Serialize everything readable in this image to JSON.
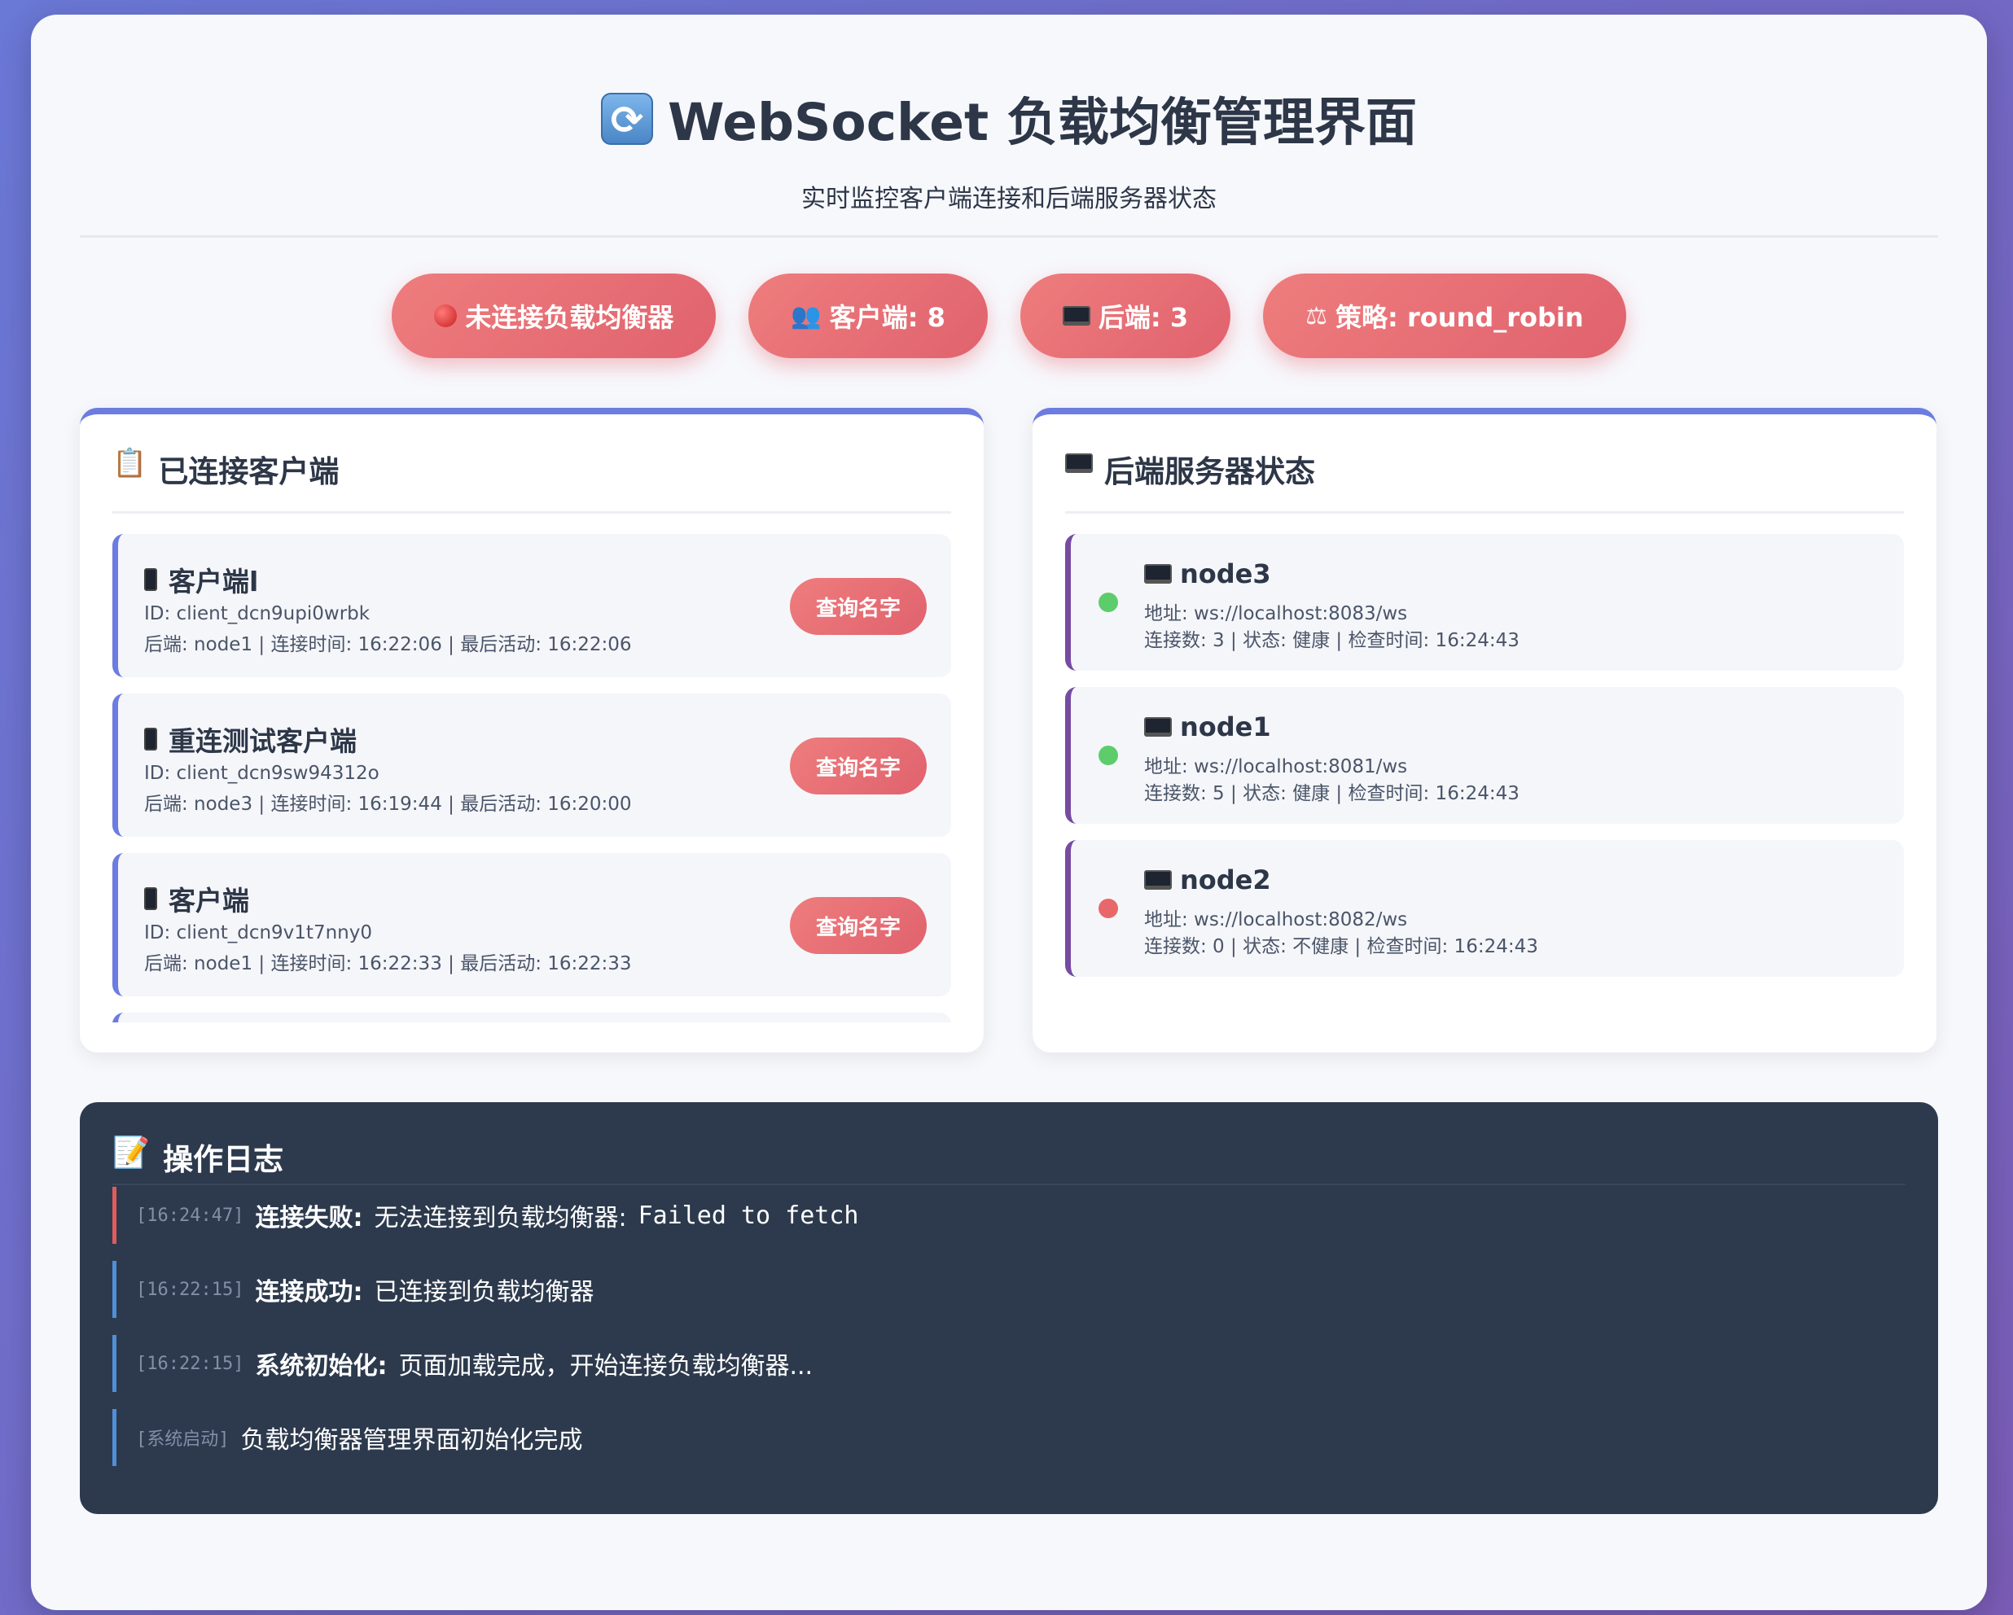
{
  "header": {
    "title": "WebSocket 负载均衡管理界面",
    "subtitle": "实时监控客户端连接和后端服务器状态"
  },
  "stats": {
    "connection": "未连接负载均衡器",
    "clients": "客户端: 8",
    "backends": "后端: 3",
    "strategy": "策略: round_robin"
  },
  "clients_panel": {
    "title": "已连接客户端",
    "button_label": "查询名字",
    "items": [
      {
        "name": "客户端l",
        "id": "ID: client_dcn9upi0wrbk",
        "details": "后端: node1 | 连接时间: 16:22:06 | 最后活动: 16:22:06"
      },
      {
        "name": "重连测试客户端",
        "id": "ID: client_dcn9sw94312o",
        "details": "后端: node3 | 连接时间: 16:19:44 | 最后活动: 16:20:00"
      },
      {
        "name": "客户端",
        "id": "ID: client_dcn9v1t7nny0",
        "details": "后端: node1 | 连接时间: 16:22:33 | 最后活动: 16:22:33"
      }
    ]
  },
  "backends_panel": {
    "title": "后端服务器状态",
    "items": [
      {
        "name": "node3",
        "address": "地址: ws://localhost:8083/ws",
        "details": "连接数: 3 | 状态: 健康 | 检查时间: 16:24:43",
        "healthy": true
      },
      {
        "name": "node1",
        "address": "地址: ws://localhost:8081/ws",
        "details": "连接数: 5 | 状态: 健康 | 检查时间: 16:24:43",
        "healthy": true
      },
      {
        "name": "node2",
        "address": "地址: ws://localhost:8082/ws",
        "details": "连接数: 0 | 状态: 不健康 | 检查时间: 16:24:43",
        "healthy": false
      }
    ]
  },
  "log": {
    "title": "操作日志",
    "entries": [
      {
        "time": "[16:24:47]",
        "label": "连接失败:",
        "message": "无法连接到负载均衡器:",
        "extra": "Failed to fetch",
        "level": "error"
      },
      {
        "time": "[16:22:15]",
        "label": "连接成功:",
        "message": "已连接到负载均衡器",
        "level": "info"
      },
      {
        "time": "[16:22:15]",
        "label": "系统初始化:",
        "message": "页面加载完成，开始连接负载均衡器...",
        "level": "info"
      },
      {
        "time": "[系统启动]",
        "label": "",
        "message": "负载均衡器管理界面初始化完成",
        "level": "info"
      }
    ]
  },
  "colors": {
    "accent": "#6c7ce0",
    "pill": "#e0626e",
    "healthy": "#5ccd6a",
    "unhealthy": "#e8676b",
    "log_bg": "#2d3a4d"
  }
}
